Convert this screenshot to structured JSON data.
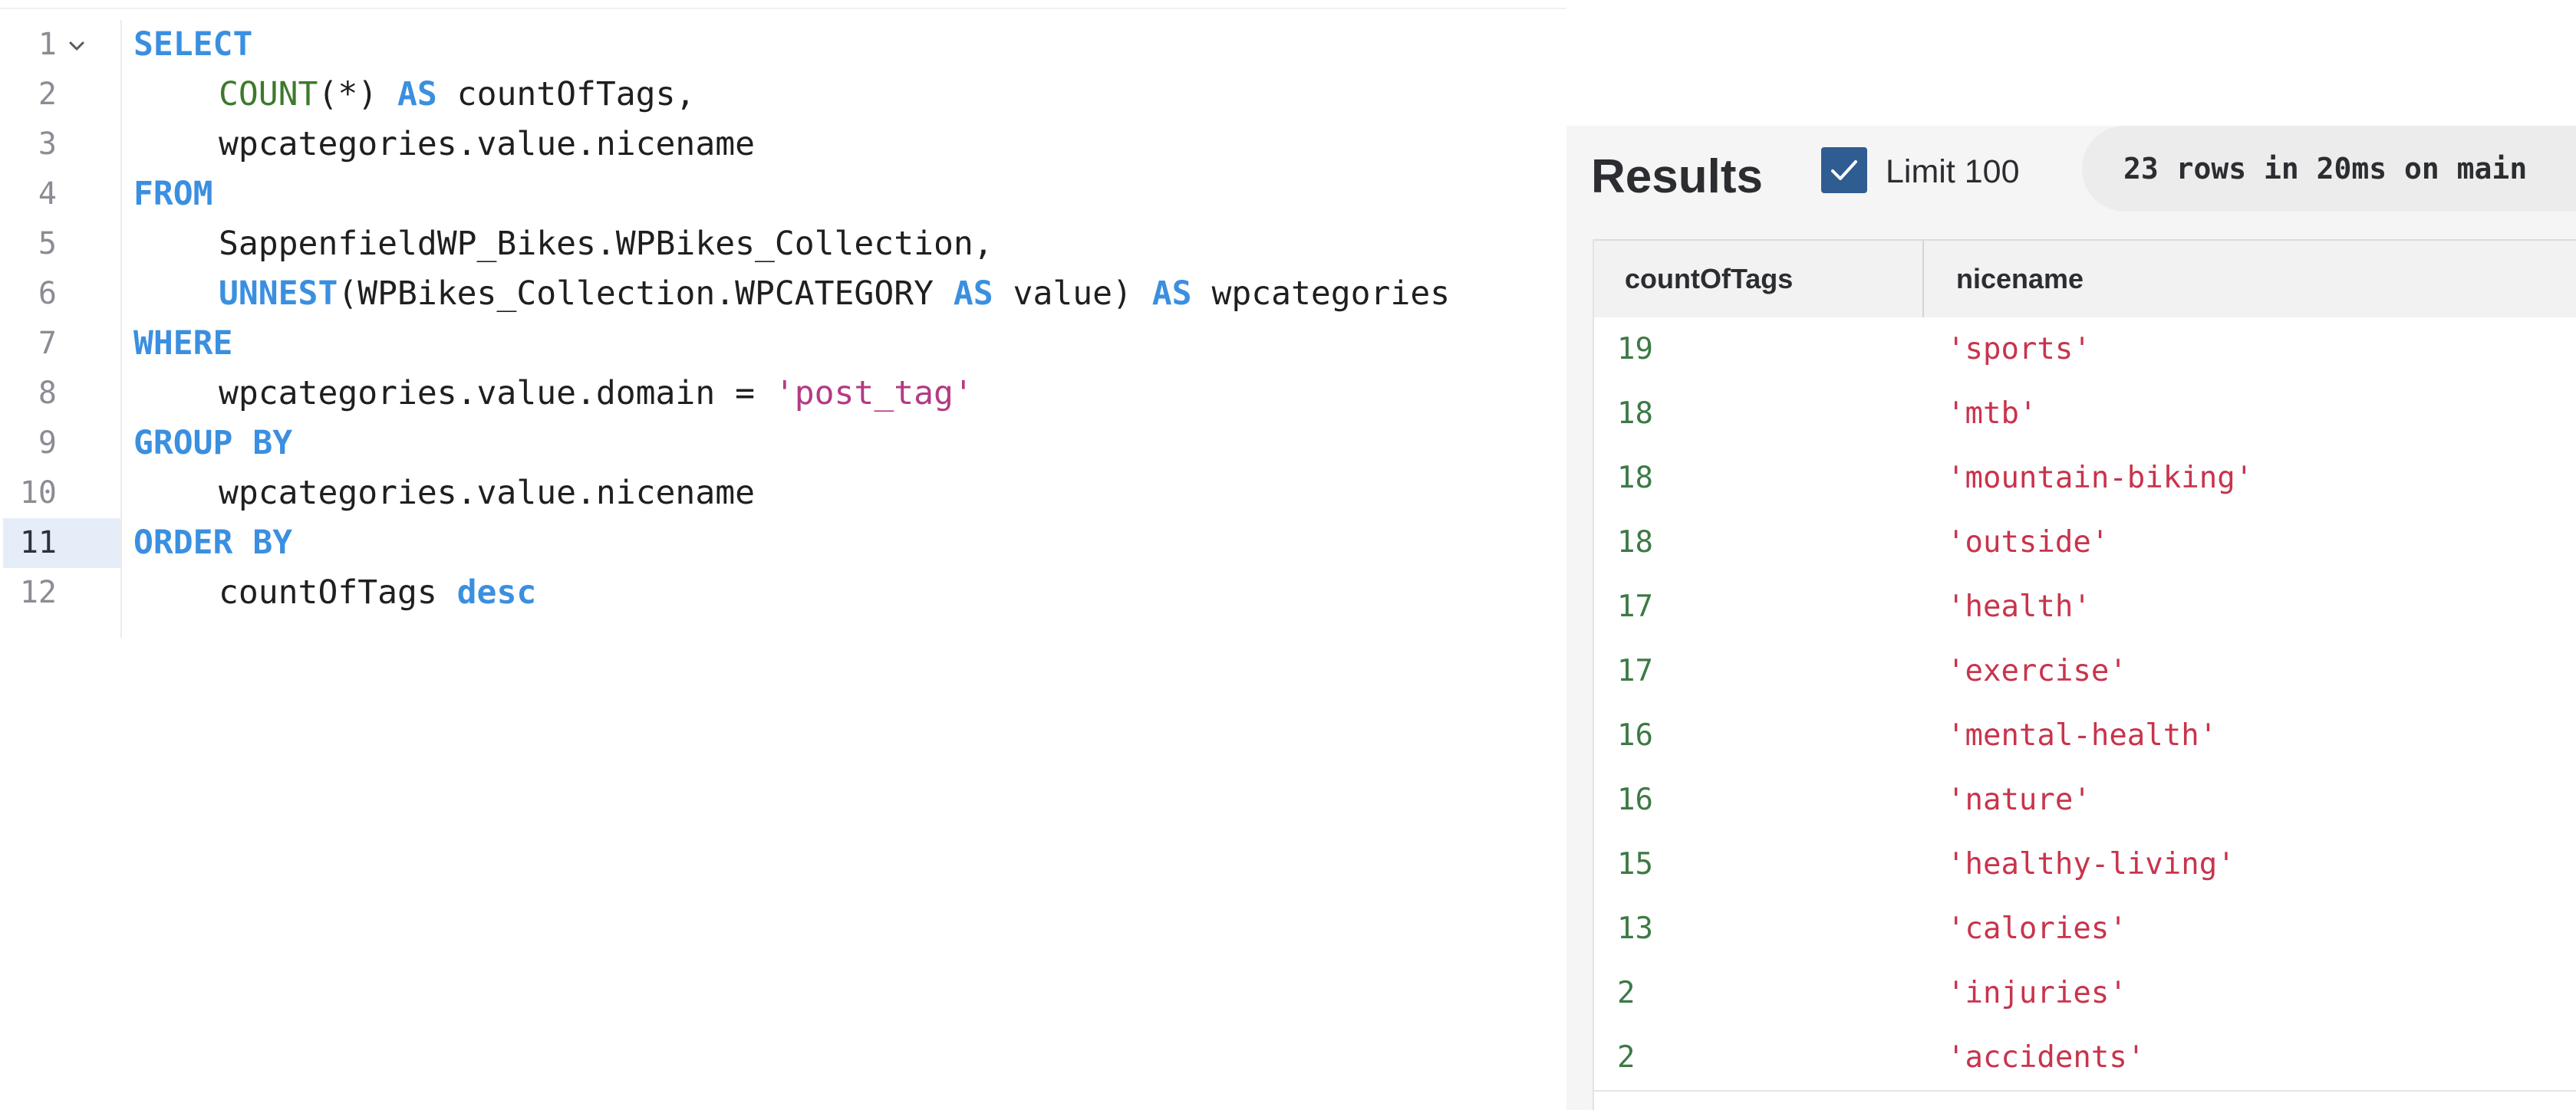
{
  "editor": {
    "lines": [
      {
        "n": "1",
        "fold": true,
        "tokens": [
          {
            "t": "SELECT",
            "k": "kw"
          }
        ],
        "indent": false
      },
      {
        "n": "2",
        "tokens": [
          {
            "t": "COUNT",
            "k": "fn"
          },
          {
            "t": "(*) ",
            "k": "plain"
          },
          {
            "t": "AS",
            "k": "kw"
          },
          {
            "t": " countOfTags,",
            "k": "plain"
          }
        ],
        "indent": true
      },
      {
        "n": "3",
        "tokens": [
          {
            "t": "wpcategories.value.nicename",
            "k": "plain"
          }
        ],
        "indent": true
      },
      {
        "n": "4",
        "tokens": [
          {
            "t": "FROM",
            "k": "kw"
          }
        ],
        "indent": false
      },
      {
        "n": "5",
        "tokens": [
          {
            "t": "SappenfieldWP_Bikes.WPBikes_Collection,",
            "k": "plain"
          }
        ],
        "indent": true
      },
      {
        "n": "6",
        "tokens": [
          {
            "t": "UNNEST",
            "k": "kw"
          },
          {
            "t": "(WPBikes_Collection.WPCATEGORY ",
            "k": "plain"
          },
          {
            "t": "AS",
            "k": "kw"
          },
          {
            "t": " value) ",
            "k": "plain"
          },
          {
            "t": "AS",
            "k": "kw"
          },
          {
            "t": " wpcategories",
            "k": "plain"
          }
        ],
        "indent": true
      },
      {
        "n": "7",
        "tokens": [
          {
            "t": "WHERE",
            "k": "kw"
          }
        ],
        "indent": false
      },
      {
        "n": "8",
        "tokens": [
          {
            "t": "wpcategories.value.domain = ",
            "k": "plain"
          },
          {
            "t": "'post_tag'",
            "k": "str"
          }
        ],
        "indent": true
      },
      {
        "n": "9",
        "tokens": [
          {
            "t": "GROUP BY",
            "k": "kw"
          }
        ],
        "indent": false
      },
      {
        "n": "10",
        "tokens": [
          {
            "t": "wpcategories.value.nicename",
            "k": "plain"
          }
        ],
        "indent": true
      },
      {
        "n": "11",
        "active": true,
        "tokens": [
          {
            "t": "ORDER BY",
            "k": "kw"
          }
        ],
        "indent": false
      },
      {
        "n": "12",
        "tokens": [
          {
            "t": "countOfTags ",
            "k": "plain"
          },
          {
            "t": "desc",
            "k": "kw"
          }
        ],
        "indent": true
      }
    ]
  },
  "results": {
    "title": "Results",
    "limit_label": "Limit 100",
    "limit_checked": true,
    "stats": "23 rows in 20ms on main",
    "columns": [
      "countOfTags",
      "nicename"
    ],
    "rows": [
      [
        "19",
        "'sports'"
      ],
      [
        "18",
        "'mtb'"
      ],
      [
        "18",
        "'mountain-biking'"
      ],
      [
        "18",
        "'outside'"
      ],
      [
        "17",
        "'health'"
      ],
      [
        "17",
        "'exercise'"
      ],
      [
        "16",
        "'mental-health'"
      ],
      [
        "16",
        "'nature'"
      ],
      [
        "15",
        "'healthy-living'"
      ],
      [
        "13",
        "'calories'"
      ],
      [
        "2",
        "'injuries'"
      ],
      [
        "2",
        "'accidents'"
      ]
    ]
  },
  "colors": {
    "keyword": "#3b8fe0",
    "function": "#3d7a2c",
    "string": "#b43a84",
    "number_cell": "#3d7a45",
    "string_cell": "#c8344c",
    "checkbox": "#2f5d91"
  },
  "icons": {
    "fold": "chevron-down-icon",
    "checkbox": "checkmark-icon"
  }
}
